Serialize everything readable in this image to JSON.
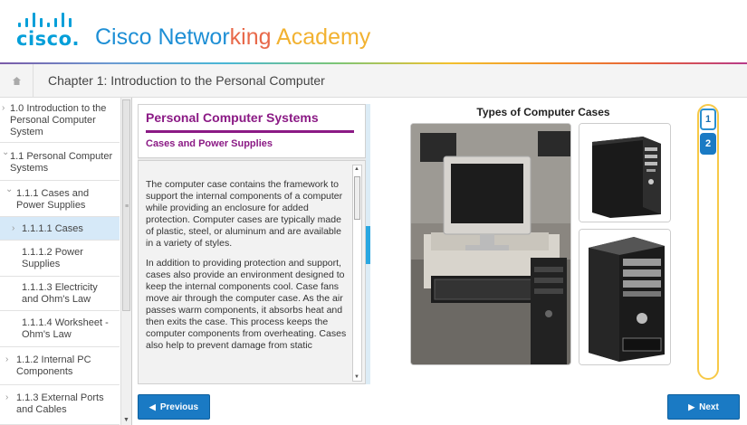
{
  "header": {
    "logo_text": "cisco.",
    "academy_title_parts": [
      {
        "text": "Cisco Networ",
        "color": "#1e8fd5"
      },
      {
        "text": "king ",
        "color": "#e8694a"
      },
      {
        "text": "Academy",
        "color": "#f2b231"
      }
    ]
  },
  "chapter": {
    "home_icon": "home-icon",
    "title": "Chapter 1: Introduction to the Personal Computer"
  },
  "sidebar": {
    "items": [
      {
        "label": "1.0 Introduction to the Personal Computer System",
        "chevron": "›"
      },
      {
        "label": "1.1 Personal Computer Systems",
        "chevron": "⌄"
      },
      {
        "label": "1.1.1 Cases and Power Supplies",
        "chevron": "⌄"
      },
      {
        "label": "1.1.1.1 Cases",
        "chevron": "›",
        "active": true
      },
      {
        "label": "1.1.1.2 Power Supplies",
        "chevron": ""
      },
      {
        "label": "1.1.1.3 Electricity and Ohm's Law",
        "chevron": ""
      },
      {
        "label": "1.1.1.4 Worksheet - Ohm's Law",
        "chevron": ""
      },
      {
        "label": "1.1.2 Internal PC Components",
        "chevron": "›"
      },
      {
        "label": "1.1.3 External Ports and Cables",
        "chevron": "›"
      }
    ]
  },
  "content": {
    "title": "Personal Computer Systems",
    "subtitle": "Cases and Power Supplies",
    "paragraph1": "The computer case contains the framework to support the internal components of a computer while providing an enclosure for added protection. Computer cases are typically made of plastic, steel, or aluminum and are available in a variety of styles.",
    "paragraph2": "In addition to providing protection and support, cases also provide an environment designed to keep the internal components cool. Case fans move air through the computer case. As the air passes warm components, it absorbs heat and then exits the case. This process keeps the computer components from overheating. Cases also help to prevent damage from static"
  },
  "media": {
    "title": "Types of Computer Cases"
  },
  "pager": {
    "pages": [
      "1",
      "2"
    ],
    "current": "1"
  },
  "nav": {
    "previous_label": "Previous",
    "next_label": "Next"
  },
  "colors": {
    "accent_blue": "#1a7ac4",
    "heading_purple": "#8b1a85",
    "active_nav": "#d6e9f8"
  }
}
